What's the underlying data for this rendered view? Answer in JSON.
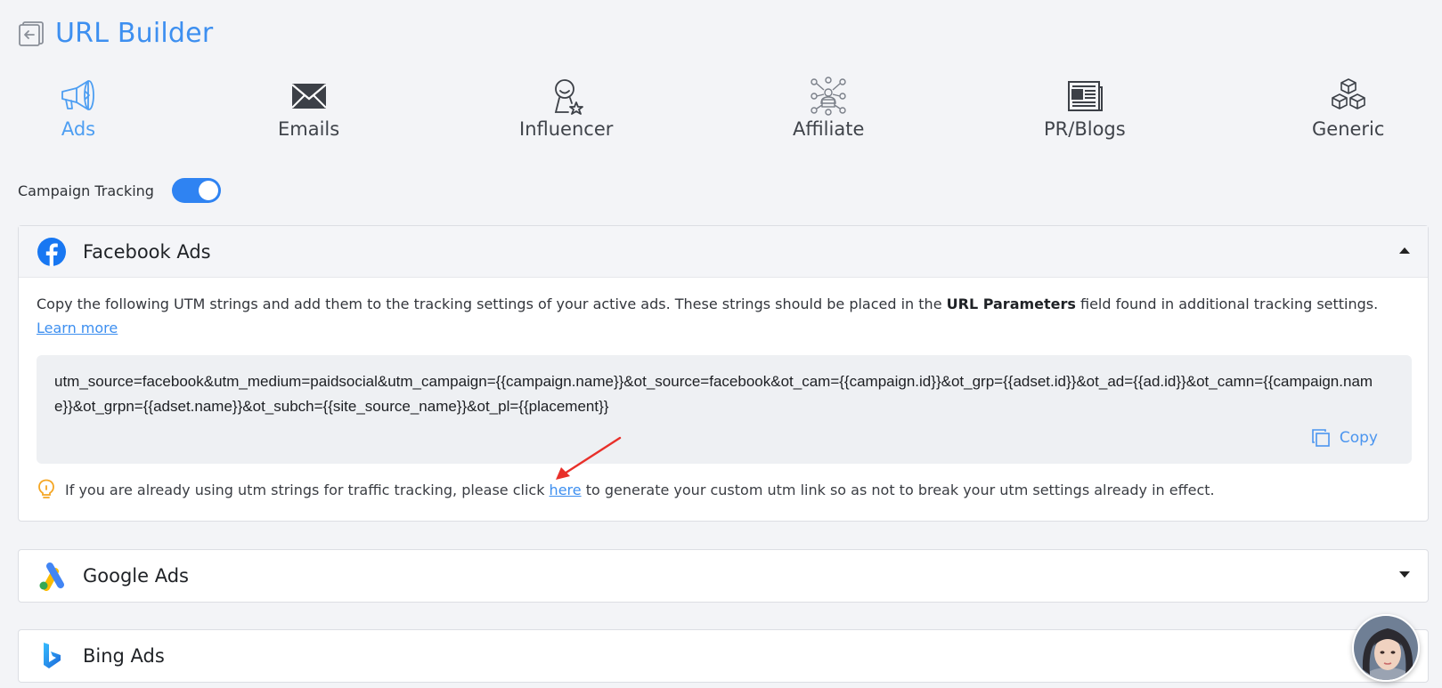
{
  "header": {
    "title": "URL Builder",
    "back_icon": "back-icon"
  },
  "tabs": [
    {
      "label": "Ads",
      "icon": "megaphone-icon",
      "active": true
    },
    {
      "label": "Emails",
      "icon": "envelope-icon",
      "active": false
    },
    {
      "label": "Influencer",
      "icon": "influencer-icon",
      "active": false
    },
    {
      "label": "Affiliate",
      "icon": "affiliate-network-icon",
      "active": false
    },
    {
      "label": "PR/Blogs",
      "icon": "newspaper-icon",
      "active": false
    },
    {
      "label": "Generic",
      "icon": "cubes-icon",
      "active": false
    }
  ],
  "campaign_tracking": {
    "label": "Campaign Tracking",
    "enabled": true
  },
  "facebook": {
    "title": "Facebook Ads",
    "desc_pre": "Copy the following UTM strings and add them to the tracking settings of your active ads. These strings should be placed in the ",
    "desc_bold": "URL Parameters",
    "desc_post": " field found in additional tracking settings. ",
    "learn_more": "Learn more",
    "utm_string": "utm_source=facebook&utm_medium=paidsocial&utm_campaign={{campaign.name}}&ot_source=facebook&ot_cam={{campaign.id}}&ot_grp={{adset.id}}&ot_ad={{ad.id}}&ot_camn={{campaign.name}}&ot_grpn={{adset.name}}&ot_subch={{site_source_name}}&ot_pl={{placement}}",
    "copy_label": "Copy",
    "tip_pre": "If you are already using utm strings for traffic tracking, please click ",
    "tip_link": "here",
    "tip_post": " to generate your custom utm link so as not to break your utm settings already in effect."
  },
  "google": {
    "title": "Google Ads"
  },
  "bing": {
    "title": "Bing Ads"
  },
  "colors": {
    "accent": "#3d8ff0",
    "toggle_on": "#2f83f2",
    "facebook": "#1877f2",
    "annotation_arrow": "#e8302a"
  }
}
